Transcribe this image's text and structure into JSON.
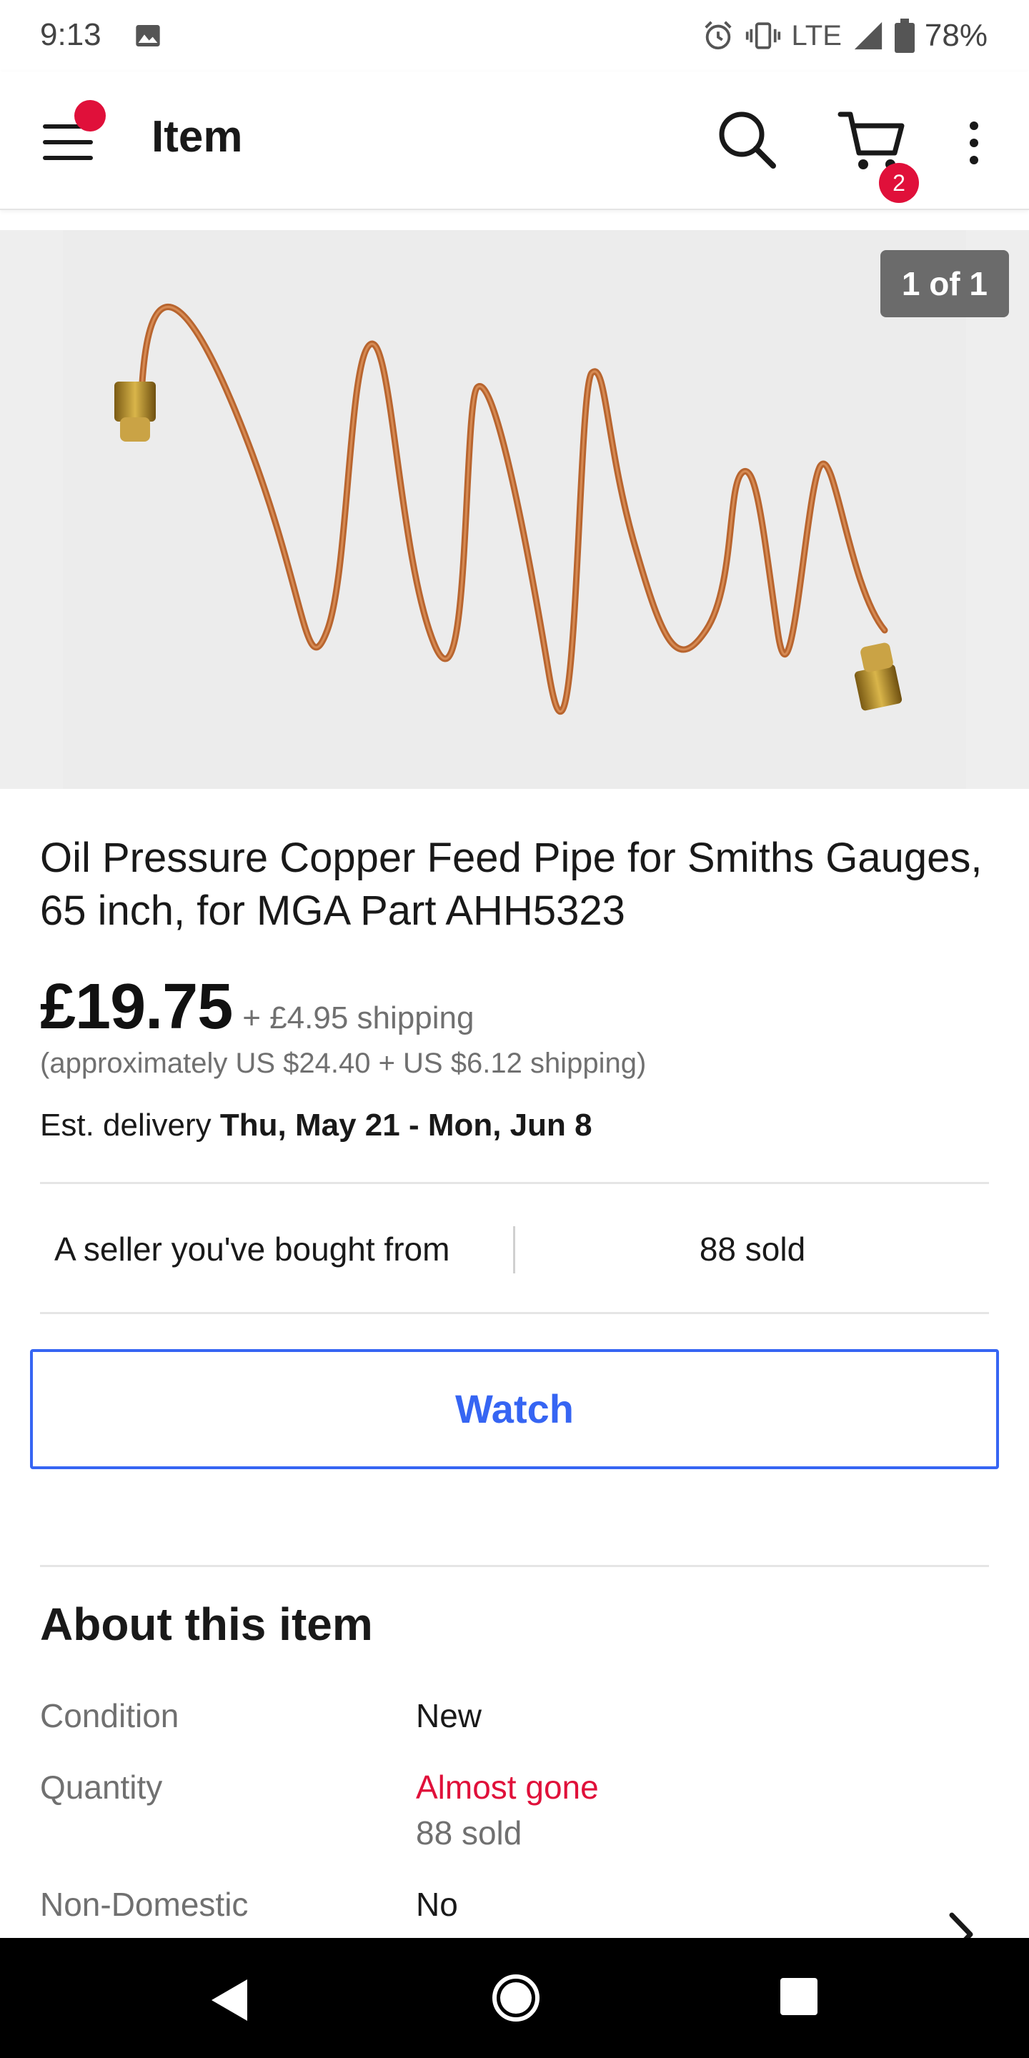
{
  "status_bar": {
    "time": "9:13",
    "network": "LTE",
    "battery": "78%",
    "icons": [
      "image-icon",
      "alarm-icon",
      "vibrate-icon",
      "signal-icon",
      "battery-icon"
    ]
  },
  "app_bar": {
    "title": "Item",
    "cart_count": "2",
    "icons": [
      "menu-icon",
      "search-icon",
      "cart-icon",
      "more-vert-icon"
    ]
  },
  "gallery": {
    "counter": "1 of 1"
  },
  "listing": {
    "title": "Oil Pressure Copper Feed Pipe for Smiths Gauges, 65 inch, for MGA Part AHH5323",
    "price": "£19.75",
    "shipping": "+ £4.95 shipping",
    "approx": "(approximately US $24.40 + US $6.12 shipping)",
    "delivery_label": "Est. delivery ",
    "delivery_dates": "Thu, May 21 - Mon, Jun 8"
  },
  "seller": {
    "note": "A seller you've bought from",
    "sold": "88 sold"
  },
  "actions": {
    "watch_label": "Watch"
  },
  "about": {
    "heading": "About this item",
    "specs": [
      {
        "label": "Condition",
        "value": "New"
      },
      {
        "label": "Quantity",
        "value": "Almost gone",
        "sub": "88 sold"
      },
      {
        "label": "Non-Domestic",
        "value": "No"
      }
    ]
  },
  "colors": {
    "accent_blue": "#3665f3",
    "alert_red": "#e0103a",
    "copper": "#b8652f"
  }
}
